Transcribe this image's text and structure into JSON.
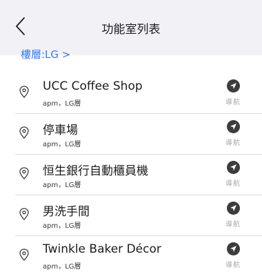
{
  "header": {
    "title": "功能室列表",
    "back_icon": "chevron-left-icon"
  },
  "floor": {
    "label": "樓層:LG >"
  },
  "items": [
    {
      "title": "UCC Coffee Shop",
      "subtitle": "apm，LG層",
      "nav_label": "導航"
    },
    {
      "title": "停車場",
      "subtitle": "apm，LG層",
      "nav_label": "導航"
    },
    {
      "title": "恒生銀行自動櫃員機",
      "subtitle": "apm，LG層",
      "nav_label": "導航"
    },
    {
      "title": "男洗手間",
      "subtitle": "apm，LG層",
      "nav_label": "導航"
    },
    {
      "title": "Twinkle Baker Décor",
      "subtitle": "apm，LG層",
      "nav_label": "導航"
    }
  ],
  "colors": {
    "accent": "#3478f6",
    "nav_bg": "#f2f2f6",
    "icon_dark": "#3c3c3c"
  }
}
